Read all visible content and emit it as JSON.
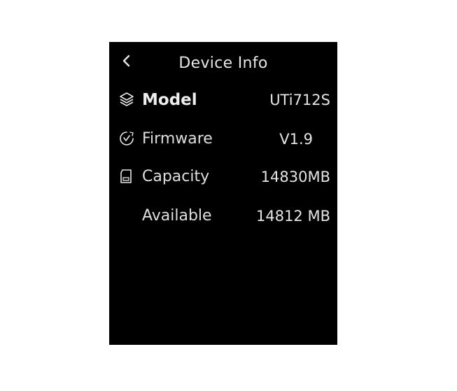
{
  "header": {
    "title": "Device Info",
    "back_icon": "chevron-left-icon"
  },
  "rows": [
    {
      "icon": "layers-icon",
      "label": "Model",
      "value": "UTi712S"
    },
    {
      "icon": "firmware-check-icon",
      "label": "Firmware",
      "value": "V1.9"
    },
    {
      "icon": "sd-card-icon",
      "label": "Capacity",
      "value": "14830MB"
    },
    {
      "icon": "",
      "label": "Available",
      "value": "14812 MB"
    }
  ],
  "colors": {
    "screen_background": "#000000",
    "text": "#e6e6e6",
    "page_background": "#ffffff"
  }
}
